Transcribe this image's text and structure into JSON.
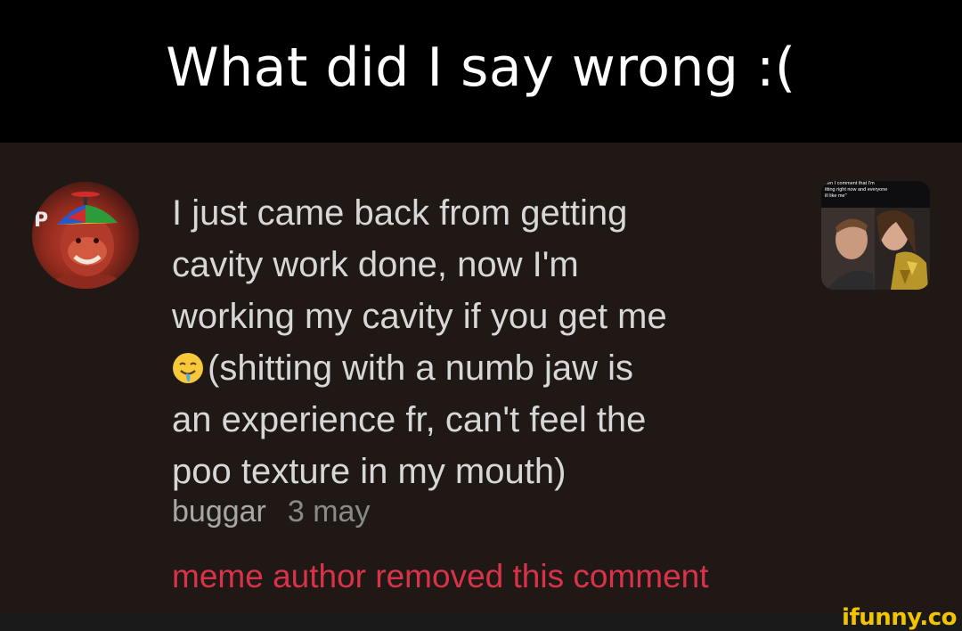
{
  "caption": {
    "text": "What did I say wrong :("
  },
  "comment": {
    "lines": [
      "I just came back from getting",
      "cavity work done, now I'm",
      "working my cavity if you get me",
      "(shitting with a numb jaw is",
      "an experience fr, can't feel the",
      "poo texture in my mouth)"
    ],
    "emoji": "drooling-face-emoji",
    "author": "buggar",
    "time": "3 may",
    "removed_notice": "meme author removed this comment"
  },
  "thumbnail": {
    "caption_lines": [
      "..en I comment that I'm",
      "itting right now and everyone",
      "ill like me\""
    ]
  },
  "watermark": {
    "text": "ifunny.co"
  },
  "colors": {
    "caption_bg": "#000000",
    "panel_bg": "#201814",
    "comment_text": "#d7d7d7",
    "meta_text": "#9a9a9a",
    "removed_text": "#d8334a",
    "watermark": "#f2c400"
  }
}
